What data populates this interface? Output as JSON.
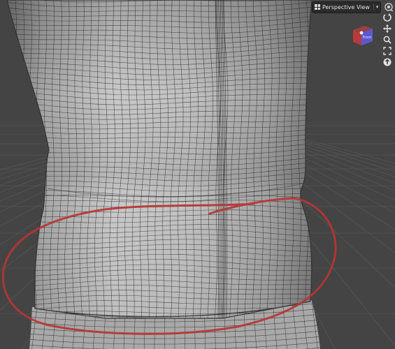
{
  "viewport": {
    "view_name": "Perspective View",
    "chevron_glyph": "▾",
    "gizmo_face_label": "Front"
  },
  "header_icons": [
    "view-grid-icon",
    "chevron-down-icon",
    "camera-icon",
    "menu-icon"
  ],
  "nav_tools": [
    "orbit-icon",
    "pan-icon",
    "zoom-icon",
    "frame-icon",
    "home-icon"
  ],
  "colors": {
    "background": "#444444",
    "grid_line": "#585858",
    "mesh_surface": "#b8b8b8",
    "mesh_wire": "#1c1c1c",
    "annotation_stroke": "#b73535",
    "gizmo_front": "#5a5ad0",
    "gizmo_side": "#b83a3a"
  }
}
